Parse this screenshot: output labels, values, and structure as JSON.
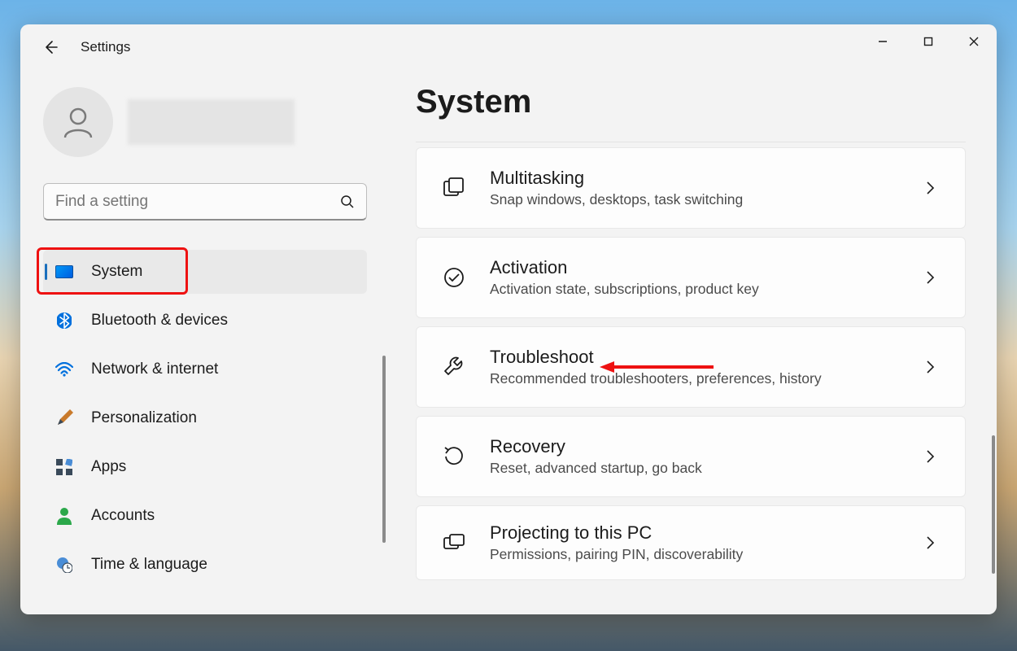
{
  "app": {
    "title": "Settings"
  },
  "search": {
    "placeholder": "Find a setting"
  },
  "sidebar": {
    "items": [
      {
        "label": "System"
      },
      {
        "label": "Bluetooth & devices"
      },
      {
        "label": "Network & internet"
      },
      {
        "label": "Personalization"
      },
      {
        "label": "Apps"
      },
      {
        "label": "Accounts"
      },
      {
        "label": "Time & language"
      }
    ],
    "active_index": 0
  },
  "page": {
    "title": "System"
  },
  "settings": [
    {
      "title": "Multitasking",
      "subtitle": "Snap windows, desktops, task switching"
    },
    {
      "title": "Activation",
      "subtitle": "Activation state, subscriptions, product key"
    },
    {
      "title": "Troubleshoot",
      "subtitle": "Recommended troubleshooters, preferences, history"
    },
    {
      "title": "Recovery",
      "subtitle": "Reset, advanced startup, go back"
    },
    {
      "title": "Projecting to this PC",
      "subtitle": "Permissions, pairing PIN, discoverability"
    }
  ],
  "annotations": {
    "sidebar_highlight": {
      "item_index": 0
    },
    "arrow_target": {
      "setting_index": 2
    }
  }
}
